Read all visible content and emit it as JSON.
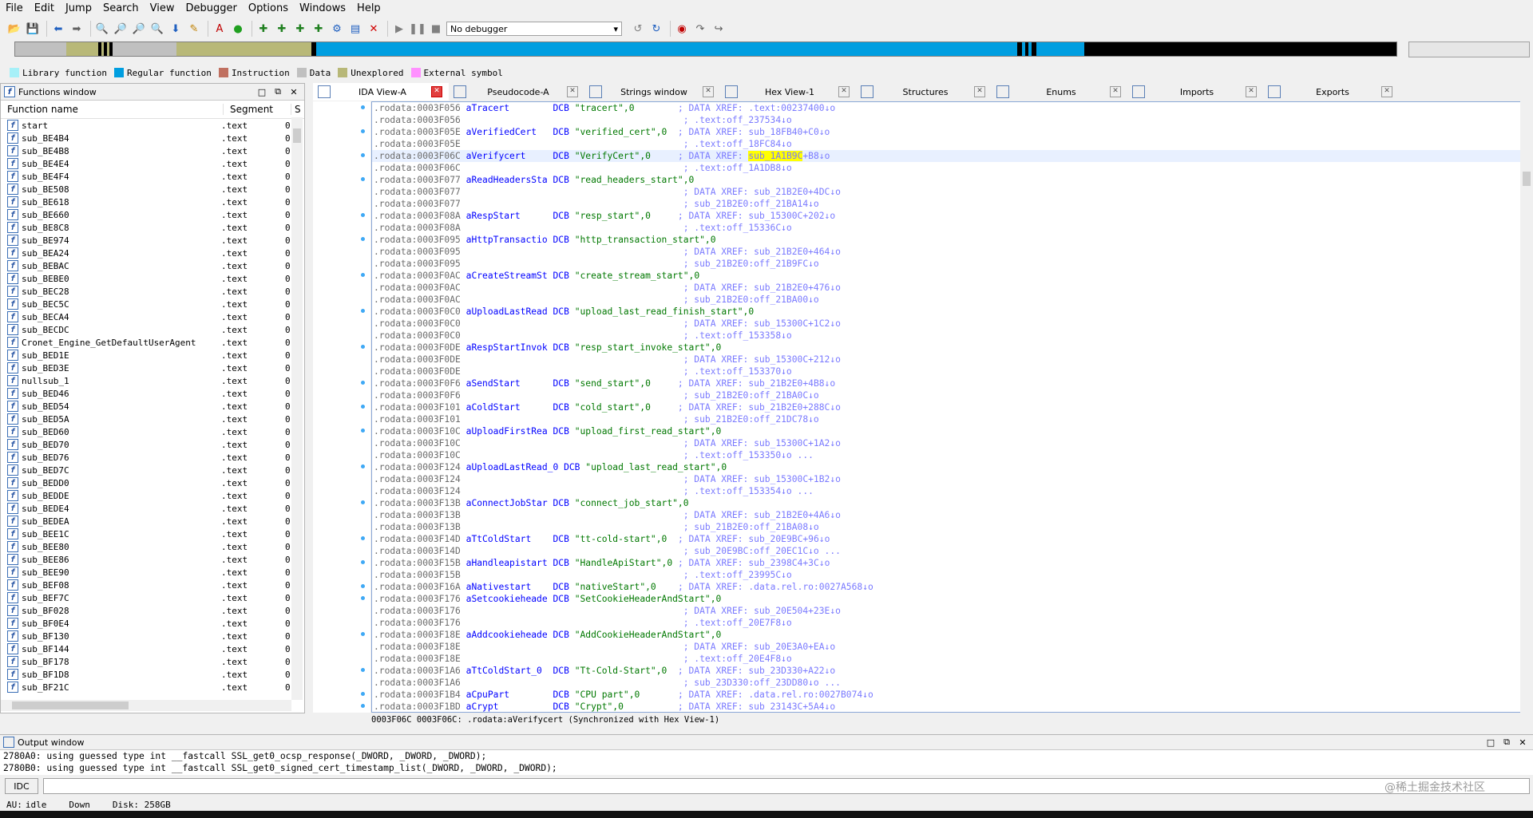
{
  "menu": [
    "File",
    "Edit",
    "Jump",
    "Search",
    "View",
    "Debugger",
    "Options",
    "Windows",
    "Help"
  ],
  "toolbar": {
    "debugger_selected": "No debugger"
  },
  "legend": [
    {
      "label": "Library function",
      "color": "#a6f0f8"
    },
    {
      "label": "Regular function",
      "color": "#009ee0"
    },
    {
      "label": "Instruction",
      "color": "#c07060"
    },
    {
      "label": "Data",
      "color": "#c0c0c0"
    },
    {
      "label": "Unexplored",
      "color": "#b8b878"
    },
    {
      "label": "External symbol",
      "color": "#ff90ff"
    }
  ],
  "functions": {
    "title": "Functions window",
    "col_name": "Function name",
    "col_segment": "Segment",
    "col_s": "S",
    "rows": [
      {
        "name": "start",
        "seg": ".text"
      },
      {
        "name": "sub_BE4B4",
        "seg": ".text"
      },
      {
        "name": "sub_BE4B8",
        "seg": ".text"
      },
      {
        "name": "sub_BE4E4",
        "seg": ".text"
      },
      {
        "name": "sub_BE4F4",
        "seg": ".text"
      },
      {
        "name": "sub_BE508",
        "seg": ".text"
      },
      {
        "name": "sub_BE618",
        "seg": ".text"
      },
      {
        "name": "sub_BE660",
        "seg": ".text"
      },
      {
        "name": "sub_BE8C8",
        "seg": ".text"
      },
      {
        "name": "sub_BE974",
        "seg": ".text"
      },
      {
        "name": "sub_BEA24",
        "seg": ".text"
      },
      {
        "name": "sub_BEBAC",
        "seg": ".text"
      },
      {
        "name": "sub_BEBE0",
        "seg": ".text"
      },
      {
        "name": "sub_BEC28",
        "seg": ".text"
      },
      {
        "name": "sub_BEC5C",
        "seg": ".text"
      },
      {
        "name": "sub_BECA4",
        "seg": ".text"
      },
      {
        "name": "sub_BECDC",
        "seg": ".text"
      },
      {
        "name": "Cronet_Engine_GetDefaultUserAgent",
        "seg": ".text"
      },
      {
        "name": "sub_BED1E",
        "seg": ".text"
      },
      {
        "name": "sub_BED3E",
        "seg": ".text"
      },
      {
        "name": "nullsub_1",
        "seg": ".text"
      },
      {
        "name": "sub_BED46",
        "seg": ".text"
      },
      {
        "name": "sub_BED54",
        "seg": ".text"
      },
      {
        "name": "sub_BED5A",
        "seg": ".text"
      },
      {
        "name": "sub_BED60",
        "seg": ".text"
      },
      {
        "name": "sub_BED70",
        "seg": ".text"
      },
      {
        "name": "sub_BED76",
        "seg": ".text"
      },
      {
        "name": "sub_BED7C",
        "seg": ".text"
      },
      {
        "name": "sub_BEDD0",
        "seg": ".text"
      },
      {
        "name": "sub_BEDDE",
        "seg": ".text"
      },
      {
        "name": "sub_BEDE4",
        "seg": ".text"
      },
      {
        "name": "sub_BEDEA",
        "seg": ".text"
      },
      {
        "name": "sub_BEE1C",
        "seg": ".text"
      },
      {
        "name": "sub_BEE80",
        "seg": ".text"
      },
      {
        "name": "sub_BEE86",
        "seg": ".text"
      },
      {
        "name": "sub_BEE90",
        "seg": ".text"
      },
      {
        "name": "sub_BEF08",
        "seg": ".text"
      },
      {
        "name": "sub_BEF7C",
        "seg": ".text"
      },
      {
        "name": "sub_BF028",
        "seg": ".text"
      },
      {
        "name": "sub_BF0E4",
        "seg": ".text"
      },
      {
        "name": "sub_BF130",
        "seg": ".text"
      },
      {
        "name": "sub_BF144",
        "seg": ".text"
      },
      {
        "name": "sub_BF178",
        "seg": ".text"
      },
      {
        "name": "sub_BF1D8",
        "seg": ".text"
      },
      {
        "name": "sub_BF21C",
        "seg": ".text"
      }
    ]
  },
  "tabs": [
    {
      "label": "IDA View-A",
      "active": true
    },
    {
      "label": "Pseudocode-A"
    },
    {
      "label": "Strings window"
    },
    {
      "label": "Hex View-1"
    },
    {
      "label": "Structures"
    },
    {
      "label": "Enums"
    },
    {
      "label": "Imports"
    },
    {
      "label": "Exports"
    }
  ],
  "disasm": [
    {
      "addr": ".rodata:0003F056",
      "label": "aTracert",
      "op": "DCB",
      "str": "\"tracert\",0",
      "pad": "        ",
      "cmt": "; DATA XREF: .text:00237400↓o",
      "dot": true
    },
    {
      "addr": ".rodata:0003F056",
      "label": "",
      "op": "",
      "str": "",
      "pad": "",
      "cmt": "; .text:off_237534↓o"
    },
    {
      "addr": ".rodata:0003F05E",
      "label": "aVerifiedCert",
      "op": "DCB",
      "str": "\"verified_cert\",0",
      "pad": "  ",
      "cmt": "; DATA XREF: sub_18FB40+C0↓o",
      "dot": true
    },
    {
      "addr": ".rodata:0003F05E",
      "label": "",
      "op": "",
      "str": "",
      "pad": "",
      "cmt": "; .text:off_18FC84↓o"
    },
    {
      "addr": ".rodata:0003F06C",
      "label": "aVerifycert",
      "op": "DCB",
      "str": "\"VerifyCert\",0",
      "pad": "     ",
      "cmt_pre": "; DATA XREF: ",
      "cmt_hl": "sub_1A1B9C",
      "cmt": "+B8↓o",
      "dot": true,
      "current": true
    },
    {
      "addr": ".rodata:0003F06C",
      "label": "",
      "op": "",
      "str": "",
      "pad": "",
      "cmt": "; .text:off_1A1DB8↓o"
    },
    {
      "addr": ".rodata:0003F077",
      "label": "aReadHeadersSta",
      "op": "DCB",
      "str": "\"read_headers_start\",0",
      "pad": "",
      "cmt": "",
      "dot": true
    },
    {
      "addr": ".rodata:0003F077",
      "label": "",
      "op": "",
      "str": "",
      "pad": "",
      "cmt": "; DATA XREF: sub_21B2E0+4DC↓o"
    },
    {
      "addr": ".rodata:0003F077",
      "label": "",
      "op": "",
      "str": "",
      "pad": "",
      "cmt": "; sub_21B2E0:off_21BA14↓o"
    },
    {
      "addr": ".rodata:0003F08A",
      "label": "aRespStart",
      "op": "DCB",
      "str": "\"resp_start\",0",
      "pad": "     ",
      "cmt": "; DATA XREF: sub_15300C+202↓o",
      "dot": true
    },
    {
      "addr": ".rodata:0003F08A",
      "label": "",
      "op": "",
      "str": "",
      "pad": "",
      "cmt": "; .text:off_15336C↓o"
    },
    {
      "addr": ".rodata:0003F095",
      "label": "aHttpTransactio",
      "op": "DCB",
      "str": "\"http_transaction_start\",0",
      "pad": "",
      "cmt": "",
      "dot": true
    },
    {
      "addr": ".rodata:0003F095",
      "label": "",
      "op": "",
      "str": "",
      "pad": "",
      "cmt": "; DATA XREF: sub_21B2E0+464↓o"
    },
    {
      "addr": ".rodata:0003F095",
      "label": "",
      "op": "",
      "str": "",
      "pad": "",
      "cmt": "; sub_21B2E0:off_21B9FC↓o"
    },
    {
      "addr": ".rodata:0003F0AC",
      "label": "aCreateStreamSt",
      "op": "DCB",
      "str": "\"create_stream_start\",0",
      "pad": "",
      "cmt": "",
      "dot": true
    },
    {
      "addr": ".rodata:0003F0AC",
      "label": "",
      "op": "",
      "str": "",
      "pad": "",
      "cmt": "; DATA XREF: sub_21B2E0+476↓o"
    },
    {
      "addr": ".rodata:0003F0AC",
      "label": "",
      "op": "",
      "str": "",
      "pad": "",
      "cmt": "; sub_21B2E0:off_21BA00↓o"
    },
    {
      "addr": ".rodata:0003F0C0",
      "label": "aUploadLastRead",
      "op": "DCB",
      "str": "\"upload_last_read_finish_start\",0",
      "pad": "",
      "cmt": "",
      "dot": true
    },
    {
      "addr": ".rodata:0003F0C0",
      "label": "",
      "op": "",
      "str": "",
      "pad": "",
      "cmt": "; DATA XREF: sub_15300C+1C2↓o"
    },
    {
      "addr": ".rodata:0003F0C0",
      "label": "",
      "op": "",
      "str": "",
      "pad": "",
      "cmt": "; .text:off_153358↓o"
    },
    {
      "addr": ".rodata:0003F0DE",
      "label": "aRespStartInvok",
      "op": "DCB",
      "str": "\"resp_start_invoke_start\",0",
      "pad": "",
      "cmt": "",
      "dot": true
    },
    {
      "addr": ".rodata:0003F0DE",
      "label": "",
      "op": "",
      "str": "",
      "pad": "",
      "cmt": "; DATA XREF: sub_15300C+212↓o"
    },
    {
      "addr": ".rodata:0003F0DE",
      "label": "",
      "op": "",
      "str": "",
      "pad": "",
      "cmt": "; .text:off_153370↓o"
    },
    {
      "addr": ".rodata:0003F0F6",
      "label": "aSendStart",
      "op": "DCB",
      "str": "\"send_start\",0",
      "pad": "     ",
      "cmt": "; DATA XREF: sub_21B2E0+4B8↓o",
      "dot": true
    },
    {
      "addr": ".rodata:0003F0F6",
      "label": "",
      "op": "",
      "str": "",
      "pad": "",
      "cmt": "; sub_21B2E0:off_21BA0C↓o"
    },
    {
      "addr": ".rodata:0003F101",
      "label": "aColdStart",
      "op": "DCB",
      "str": "\"cold_start\",0",
      "pad": "     ",
      "cmt": "; DATA XREF: sub_21B2E0+288C↓o",
      "dot": true
    },
    {
      "addr": ".rodata:0003F101",
      "label": "",
      "op": "",
      "str": "",
      "pad": "",
      "cmt": "; sub_21B2E0:off_21DC78↓o"
    },
    {
      "addr": ".rodata:0003F10C",
      "label": "aUploadFirstRea",
      "op": "DCB",
      "str": "\"upload_first_read_start\",0",
      "pad": "",
      "cmt": "",
      "dot": true
    },
    {
      "addr": ".rodata:0003F10C",
      "label": "",
      "op": "",
      "str": "",
      "pad": "",
      "cmt": "; DATA XREF: sub_15300C+1A2↓o"
    },
    {
      "addr": ".rodata:0003F10C",
      "label": "",
      "op": "",
      "str": "",
      "pad": "",
      "cmt": "; .text:off_153350↓o ..."
    },
    {
      "addr": ".rodata:0003F124",
      "label": "aUploadLastRead_0",
      "op": "DCB",
      "str": "\"upload_last_read_start\",0",
      "pad": "",
      "cmt": "",
      "dot": true
    },
    {
      "addr": ".rodata:0003F124",
      "label": "",
      "op": "",
      "str": "",
      "pad": "",
      "cmt": "; DATA XREF: sub_15300C+1B2↓o"
    },
    {
      "addr": ".rodata:0003F124",
      "label": "",
      "op": "",
      "str": "",
      "pad": "",
      "cmt": "; .text:off_153354↓o ..."
    },
    {
      "addr": ".rodata:0003F13B",
      "label": "aConnectJobStar",
      "op": "DCB",
      "str": "\"connect_job_start\",0",
      "pad": "",
      "cmt": "",
      "dot": true
    },
    {
      "addr": ".rodata:0003F13B",
      "label": "",
      "op": "",
      "str": "",
      "pad": "",
      "cmt": "; DATA XREF: sub_21B2E0+4A6↓o"
    },
    {
      "addr": ".rodata:0003F13B",
      "label": "",
      "op": "",
      "str": "",
      "pad": "",
      "cmt": "; sub_21B2E0:off_21BA08↓o"
    },
    {
      "addr": ".rodata:0003F14D",
      "label": "aTtColdStart",
      "op": "DCB",
      "str": "\"tt-cold-start\",0",
      "pad": "  ",
      "cmt": "; DATA XREF: sub_20E9BC+96↓o",
      "dot": true
    },
    {
      "addr": ".rodata:0003F14D",
      "label": "",
      "op": "",
      "str": "",
      "pad": "",
      "cmt": "; sub_20E9BC:off_20EC1C↓o ..."
    },
    {
      "addr": ".rodata:0003F15B",
      "label": "aHandleapistart",
      "op": "DCB",
      "str": "\"HandleApiStart\",0",
      "pad": " ",
      "cmt": "; DATA XREF: sub_2398C4+3C↓o",
      "dot": true
    },
    {
      "addr": ".rodata:0003F15B",
      "label": "",
      "op": "",
      "str": "",
      "pad": "",
      "cmt": "; .text:off_23995C↓o"
    },
    {
      "addr": ".rodata:0003F16A",
      "label": "aNativestart",
      "op": "DCB",
      "str": "\"nativeStart\",0",
      "pad": "    ",
      "cmt": "; DATA XREF: .data.rel.ro:0027A568↓o",
      "dot": true
    },
    {
      "addr": ".rodata:0003F176",
      "label": "aSetcookieheade",
      "op": "DCB",
      "str": "\"SetCookieHeaderAndStart\",0",
      "pad": "",
      "cmt": "",
      "dot": true
    },
    {
      "addr": ".rodata:0003F176",
      "label": "",
      "op": "",
      "str": "",
      "pad": "",
      "cmt": "; DATA XREF: sub_20E504+23E↓o"
    },
    {
      "addr": ".rodata:0003F176",
      "label": "",
      "op": "",
      "str": "",
      "pad": "",
      "cmt": "; .text:off_20E7F8↓o"
    },
    {
      "addr": ".rodata:0003F18E",
      "label": "aAddcookieheade",
      "op": "DCB",
      "str": "\"AddCookieHeaderAndStart\",0",
      "pad": "",
      "cmt": "",
      "dot": true
    },
    {
      "addr": ".rodata:0003F18E",
      "label": "",
      "op": "",
      "str": "",
      "pad": "",
      "cmt": "; DATA XREF: sub_20E3A0+EA↓o"
    },
    {
      "addr": ".rodata:0003F18E",
      "label": "",
      "op": "",
      "str": "",
      "pad": "",
      "cmt": "; .text:off_20E4F8↓o"
    },
    {
      "addr": ".rodata:0003F1A6",
      "label": "aTtColdStart_0",
      "op": "DCB",
      "str": "\"Tt-Cold-Start\",0",
      "pad": "  ",
      "cmt": "; DATA XREF: sub_23D330+A22↓o",
      "dot": true
    },
    {
      "addr": ".rodata:0003F1A6",
      "label": "",
      "op": "",
      "str": "",
      "pad": "",
      "cmt": "; sub_23D330:off_23DD80↓o ..."
    },
    {
      "addr": ".rodata:0003F1B4",
      "label": "aCpuPart",
      "op": "DCB",
      "str": "\"CPU part\",0",
      "pad": "       ",
      "cmt": "; DATA XREF: .data.rel.ro:0027B074↓o",
      "dot": true
    },
    {
      "addr": ".rodata:0003F1BD",
      "label": "aCrypt",
      "op": "DCB",
      "str": "\"Crypt\",0",
      "pad": "          ",
      "cmt": "; DATA XREF: sub 23143C+5A4↓o",
      "dot": true
    }
  ],
  "disasm_status": "0003F06C 0003F06C: .rodata:aVerifycert (Synchronized with Hex View-1)",
  "output": {
    "title": "Output window",
    "lines": [
      "2780A0: using guessed type int __fastcall SSL_get0_ocsp_response(_DWORD, _DWORD, _DWORD);",
      "2780B0: using guessed type int __fastcall SSL_get0_signed_cert_timestamp_list(_DWORD, _DWORD, _DWORD);"
    ]
  },
  "idc_label": "IDC",
  "status": {
    "au": "AU:",
    "state": "idle",
    "dir": "Down",
    "disk": "Disk: 258GB"
  },
  "watermark": "@稀土掘金技术社区"
}
